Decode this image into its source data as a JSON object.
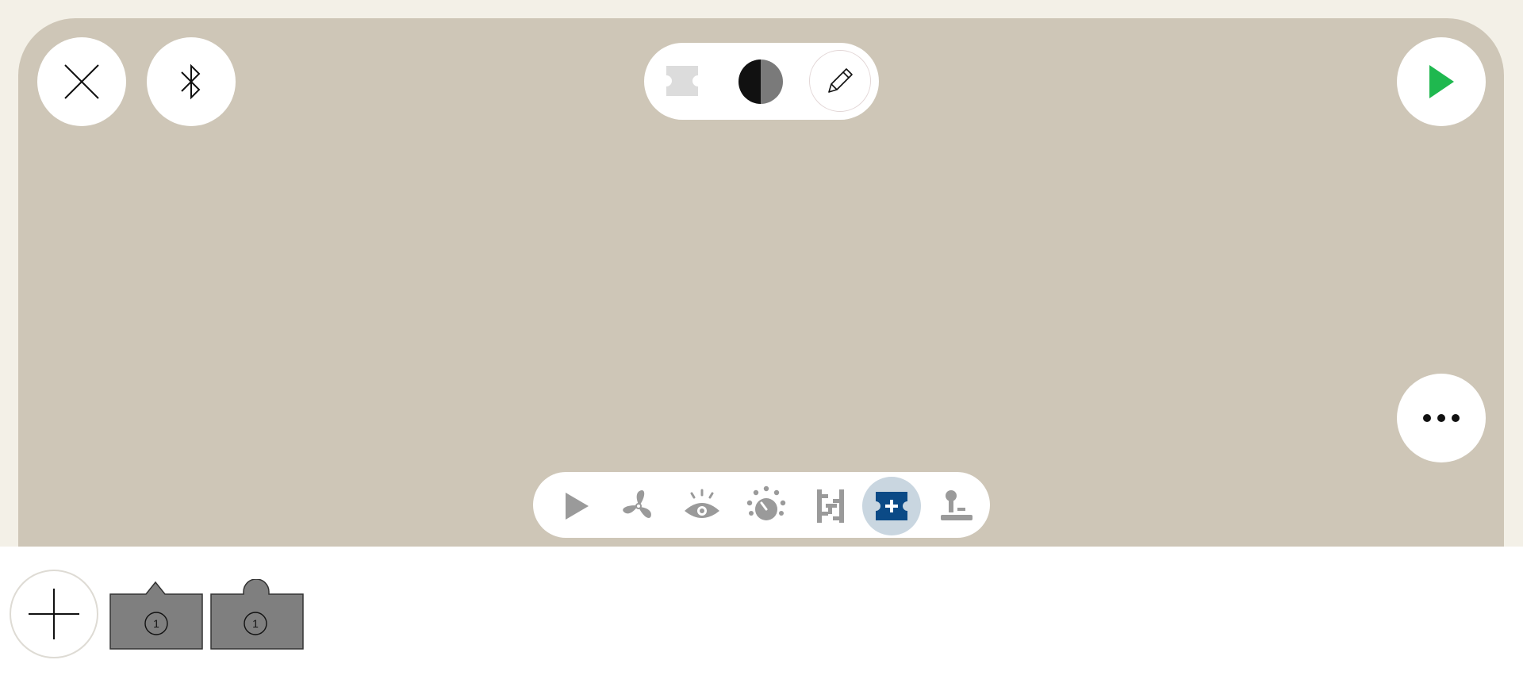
{
  "app": {
    "colors": {
      "frame": "#f3f0e7",
      "canvas": "#cec6b7",
      "play_green": "#1fb84f",
      "active_palette_blue": "#0b4a86",
      "active_palette_bg": "#c9d6e0",
      "icon_gray": "#9a9a9a"
    }
  },
  "toolbar": {
    "close_icon": "close-icon",
    "bluetooth_icon": "bluetooth-icon",
    "play_icon": "play-icon",
    "more_icon": "more-icon"
  },
  "mode_switcher": {
    "items": [
      {
        "name": "block-mode",
        "icon": "block-ticket-icon"
      },
      {
        "name": "contrast-mode",
        "icon": "contrast-icon"
      },
      {
        "name": "edit-mode",
        "icon": "pencil-icon"
      }
    ]
  },
  "palette": {
    "categories": [
      {
        "name": "start",
        "icon": "play-triangle-icon",
        "active": false
      },
      {
        "name": "motors",
        "icon": "fan-icon",
        "active": false
      },
      {
        "name": "sensors",
        "icon": "eye-icon",
        "active": false
      },
      {
        "name": "light",
        "icon": "light-icon",
        "active": false
      },
      {
        "name": "control",
        "icon": "ladder-icon",
        "active": false
      },
      {
        "name": "my-blocks",
        "icon": "add-block-icon",
        "active": true
      },
      {
        "name": "joystick",
        "icon": "joystick-icon",
        "active": false
      }
    ]
  },
  "tray": {
    "add_icon": "plus-icon",
    "blocks": [
      {
        "type": "triangle-tab",
        "number": "1"
      },
      {
        "type": "round-tab",
        "number": "1"
      }
    ]
  }
}
